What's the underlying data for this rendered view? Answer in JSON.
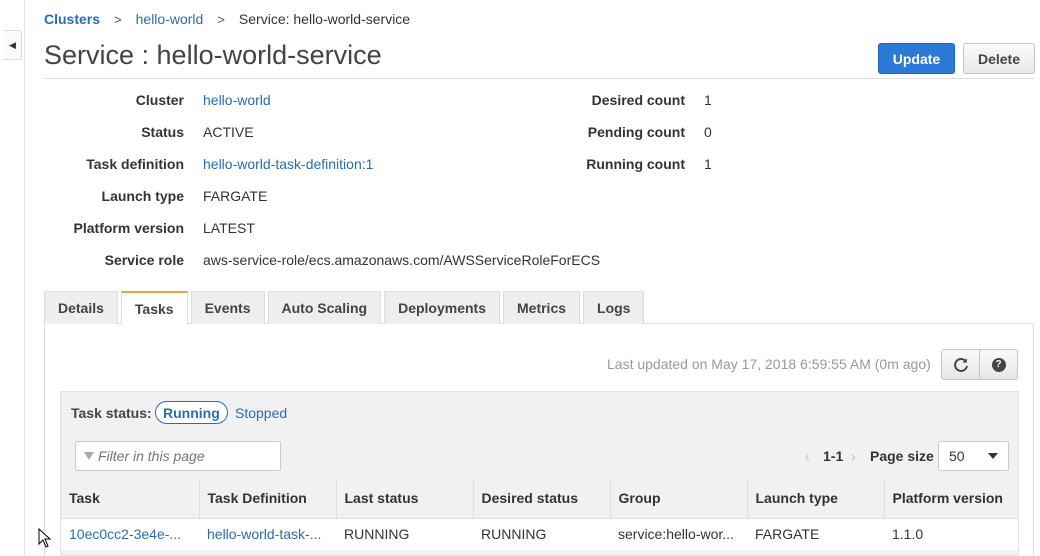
{
  "breadcrumb": {
    "clusters": "Clusters",
    "cluster": "hello-world",
    "current": "Service: hello-world-service"
  },
  "page": {
    "title": "Service : hello-world-service",
    "update_label": "Update",
    "delete_label": "Delete"
  },
  "details": {
    "cluster_label": "Cluster",
    "cluster_value": "hello-world",
    "status_label": "Status",
    "status_value": "ACTIVE",
    "task_def_label": "Task definition",
    "task_def_value": "hello-world-task-definition:1",
    "launch_type_label": "Launch type",
    "launch_type_value": "FARGATE",
    "platform_label": "Platform version",
    "platform_value": "LATEST",
    "role_label": "Service role",
    "role_value": "aws-service-role/ecs.amazonaws.com/AWSServiceRoleForECS",
    "desired_label": "Desired count",
    "desired_value": "1",
    "pending_label": "Pending count",
    "pending_value": "0",
    "running_label": "Running count",
    "running_value": "1"
  },
  "tabs": [
    "Details",
    "Tasks",
    "Events",
    "Auto Scaling",
    "Deployments",
    "Metrics",
    "Logs"
  ],
  "active_tab": "Tasks",
  "tasks_panel": {
    "last_updated": "Last updated on May 17, 2018 6:59:55 AM (0m ago)",
    "status_label": "Task status:",
    "status_running": "Running",
    "status_stopped": "Stopped",
    "filter_placeholder": "Filter in this page",
    "pager_prev": "‹",
    "pager_range": "1-1",
    "pager_next": "›",
    "page_size_label": "Page size",
    "page_size_value": "50"
  },
  "table": {
    "columns": [
      "Task",
      "Task Definition",
      "Last status",
      "Desired status",
      "Group",
      "Launch type",
      "Platform version"
    ],
    "rows": [
      [
        "10ec0cc2-3e4e-...",
        "hello-world-task-...",
        "RUNNING",
        "RUNNING",
        "service:hello-wor...",
        "FARGATE",
        "1.1.0"
      ]
    ]
  },
  "icons": {
    "refresh": "refresh-icon",
    "help": "help-icon",
    "filter": "filter-icon",
    "collapse": "collapse-left-icon"
  },
  "colors": {
    "link": "#2b6cb0",
    "primary": "#2b7bd6",
    "active_tab_accent": "#e8a33a"
  }
}
